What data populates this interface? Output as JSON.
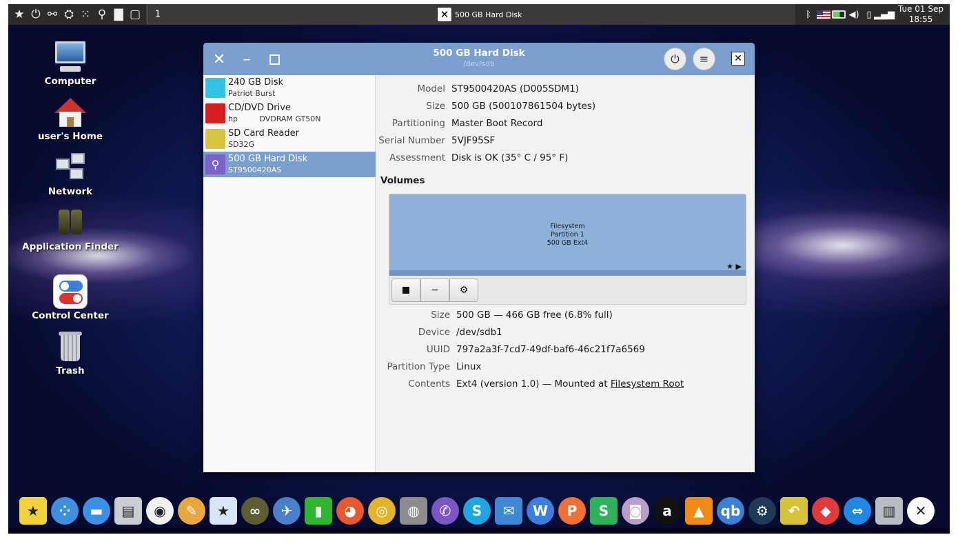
{
  "top_panel": {
    "launchers": [
      "star-icon",
      "power-icon",
      "settings-toggle-icon",
      "binoculars-icon",
      "network-icon",
      "search-icon",
      "folder-icon",
      "desktop-icon"
    ],
    "workspace": "1",
    "active_task": "500 GB Hard Disk",
    "clock_date": "Tue 01 Sep",
    "clock_time": "18:55"
  },
  "desktop": {
    "icons": [
      {
        "label": "Computer"
      },
      {
        "label": "user's Home"
      },
      {
        "label": "Network"
      },
      {
        "label": "Application Finder"
      },
      {
        "label": "Control Center"
      },
      {
        "label": "Trash"
      }
    ]
  },
  "window": {
    "title": "500 GB Hard Disk",
    "subtitle": "/dev/sdb",
    "drives": [
      {
        "name": "240 GB Disk",
        "sub": "Patriot Burst",
        "icon": "ssd-icon",
        "color": "#31c3e0"
      },
      {
        "name": "CD/DVD Drive",
        "sub": "hp         DVDRAM GT50N",
        "icon": "optical-drive-icon",
        "color": "#d62020"
      },
      {
        "name": "SD Card Reader",
        "sub": "SD32G",
        "icon": "sd-card-icon",
        "color": "#d8c440"
      },
      {
        "name": "500 GB Hard Disk",
        "sub": "ST9500420AS",
        "icon": "usb-drive-icon",
        "color": "#7a62c8",
        "selected": true
      }
    ],
    "disk": {
      "model_label": "Model",
      "model": "ST9500420AS (D005SDM1)",
      "size_label": "Size",
      "size": "500 GB (500107861504 bytes)",
      "partitioning_label": "Partitioning",
      "partitioning": "Master Boot Record",
      "serial_label": "Serial Number",
      "serial": "5VJF95SF",
      "assessment_label": "Assessment",
      "assessment": "Disk is OK (35° C / 95° F)"
    },
    "volumes_heading": "Volumes",
    "volume_block": {
      "line1": "Filesystem",
      "line2": "Partition 1",
      "line3": "500 GB Ext4",
      "flags": "★ ▶"
    },
    "partition": {
      "size_label": "Size",
      "size": "500 GB — 466 GB free (6.8% full)",
      "device_label": "Device",
      "device": "/dev/sdb1",
      "uuid_label": "UUID",
      "uuid": "797a2a3f-7cd7-49df-baf6-46c21f7a6569",
      "type_label": "Partition Type",
      "type": "Linux",
      "contents_label": "Contents",
      "contents_prefix": "Ext4 (version 1.0) — Mounted at ",
      "contents_link": "Filesystem Root"
    }
  },
  "dock": {
    "items": [
      {
        "name": "favorites-star-icon",
        "glyph": "★",
        "color": "#f2d23a"
      },
      {
        "name": "app-grid-icon",
        "glyph": "⁘",
        "color": "#3d8fe0"
      },
      {
        "name": "desktop-window-icon",
        "glyph": "▬",
        "color": "#3a8fe6"
      },
      {
        "name": "file-cabinet-icon",
        "glyph": "▤",
        "color": "#c9ccd1"
      },
      {
        "name": "control-center-icon",
        "glyph": "◉",
        "color": "#f0f0f0"
      },
      {
        "name": "color-palette-icon",
        "glyph": "✎",
        "color": "#e7a73c"
      },
      {
        "name": "software-store-icon",
        "glyph": "★",
        "color": "#d8e6f5"
      },
      {
        "name": "binoculars-icon",
        "glyph": "∞",
        "color": "#5d5d32"
      },
      {
        "name": "rocket-icon",
        "glyph": "✈",
        "color": "#4a7fc9"
      },
      {
        "name": "pipe-icon",
        "glyph": "▮",
        "color": "#2fb52f"
      },
      {
        "name": "firefox-icon",
        "glyph": "◕",
        "color": "#e8582a"
      },
      {
        "name": "chrome-icon",
        "glyph": "◎",
        "color": "#e3b32a"
      },
      {
        "name": "google-earth-pro-icon",
        "glyph": "◍",
        "color": "#8c8c8c"
      },
      {
        "name": "viber-icon",
        "glyph": "✆",
        "color": "#7b56c4"
      },
      {
        "name": "skype-icon",
        "glyph": "S",
        "color": "#1ea6e2"
      },
      {
        "name": "mail-icon",
        "glyph": "✉",
        "color": "#3e86d6"
      },
      {
        "name": "wps-writer-icon",
        "glyph": "W",
        "color": "#3a7fe0"
      },
      {
        "name": "wps-presentation-icon",
        "glyph": "P",
        "color": "#f07033"
      },
      {
        "name": "wps-spreadsheet-icon",
        "glyph": "S",
        "color": "#2fb25a"
      },
      {
        "name": "webcam-icon",
        "glyph": "◙",
        "color": "#b89ec8"
      },
      {
        "name": "amazon-icon",
        "glyph": "a",
        "color": "#111111"
      },
      {
        "name": "vlc-icon",
        "glyph": "▲",
        "color": "#f08a14"
      },
      {
        "name": "qbittorrent-icon",
        "glyph": "qb",
        "color": "#3c7fd8"
      },
      {
        "name": "steam-icon",
        "glyph": "⚙",
        "color": "#1d3a5a"
      },
      {
        "name": "backup-restore-icon",
        "glyph": "↶",
        "color": "#d8c23a"
      },
      {
        "name": "anydesk-icon",
        "glyph": "◆",
        "color": "#e23a3a"
      },
      {
        "name": "teamviewer-icon",
        "glyph": "⇔",
        "color": "#1e88e5"
      },
      {
        "name": "trash-icon",
        "glyph": "▥",
        "color": "#b8bdc4"
      },
      {
        "name": "system-tools-icon",
        "glyph": "✕",
        "color": "#ffffff"
      }
    ]
  }
}
